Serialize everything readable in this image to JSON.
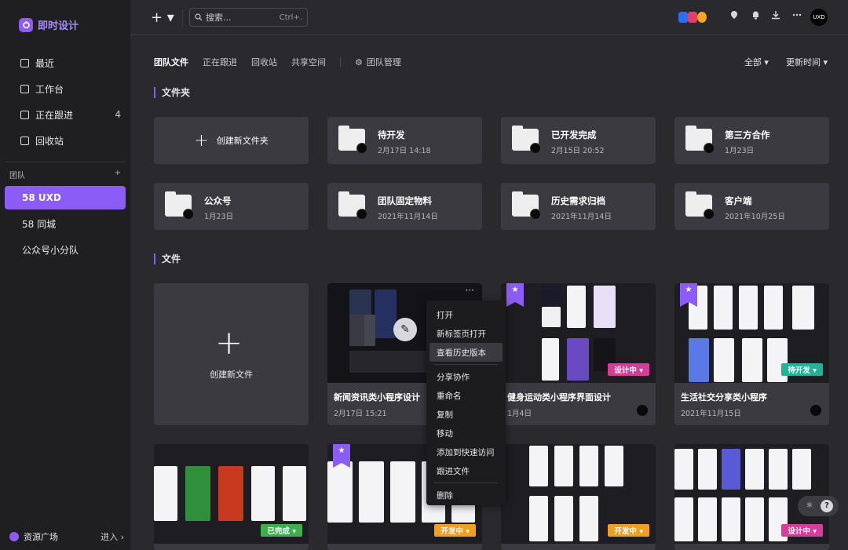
{
  "app": {
    "name": "即时设计"
  },
  "sidebar": {
    "items": [
      {
        "label": "最近"
      },
      {
        "label": "工作台"
      },
      {
        "label": "正在跟进",
        "count": "4"
      },
      {
        "label": "回收站"
      }
    ],
    "team_header": "团队",
    "team_add": "+",
    "teams": [
      {
        "label": "58 UXD"
      },
      {
        "label": "58 同城"
      },
      {
        "label": "公众号小分队"
      }
    ],
    "resource": {
      "label": "资源广场",
      "enter": "进入 ›"
    }
  },
  "topbar": {
    "add_label": "+ ▾",
    "search": {
      "placeholder": "搜索...",
      "shortcut": "Ctrl+."
    },
    "avatar_text": "UXD"
  },
  "tabs": [
    {
      "label": "团队文件"
    },
    {
      "label": "正在跟进"
    },
    {
      "label": "回收站"
    },
    {
      "label": "共享空间"
    },
    {
      "label": "团队管理"
    }
  ],
  "filters": {
    "all": "全部 ▾",
    "sort": "更新时间 ▾"
  },
  "folders_section": {
    "title": "文件夹"
  },
  "create_folder": {
    "label": "创建新文件夹"
  },
  "folders": [
    {
      "name": "待开发",
      "date": "2月17日 14:18"
    },
    {
      "name": "已开发完成",
      "date": "2月15日 20:52"
    },
    {
      "name": "第三方合作",
      "date": "1月23日"
    },
    {
      "name": "公众号",
      "date": "1月23日"
    },
    {
      "name": "团队固定物料",
      "date": "2021年11月14日"
    },
    {
      "name": "历史需求归档",
      "date": "2021年11月14日"
    },
    {
      "name": "客户端",
      "date": "2021年10月25日"
    }
  ],
  "files_section": {
    "title": "文件"
  },
  "create_file": {
    "label": "创建新文件"
  },
  "files": [
    {
      "name": "新闻资讯类小程序设计",
      "date": "2月17日 15:21"
    },
    {
      "name": "健身运动类小程序界面设计",
      "date": "1月4日",
      "status": "设计中 ▾"
    },
    {
      "name": "生活社交分享类小程序",
      "date": "2021年11月15日",
      "status": "待开发 ▾"
    },
    {
      "status": "已完成 ▾"
    },
    {
      "status": "开发中 ▾"
    },
    {
      "status": "开发中 ▾"
    },
    {
      "status": "设计中 ▾"
    }
  ],
  "context_menu": [
    {
      "label": "打开"
    },
    {
      "label": "新标签页打开"
    },
    {
      "label": "查看历史版本"
    },
    {
      "label": "分享协作"
    },
    {
      "label": "重命名"
    },
    {
      "label": "复制"
    },
    {
      "label": "移动"
    },
    {
      "label": "添加到快速访问"
    },
    {
      "label": "跟进文件"
    },
    {
      "label": "删除"
    }
  ],
  "colors": {
    "accent": "#8b5cf6",
    "design": "#d63c9a",
    "todev": "#20b39a",
    "developing": "#f0a020",
    "done": "#3eae4e"
  }
}
